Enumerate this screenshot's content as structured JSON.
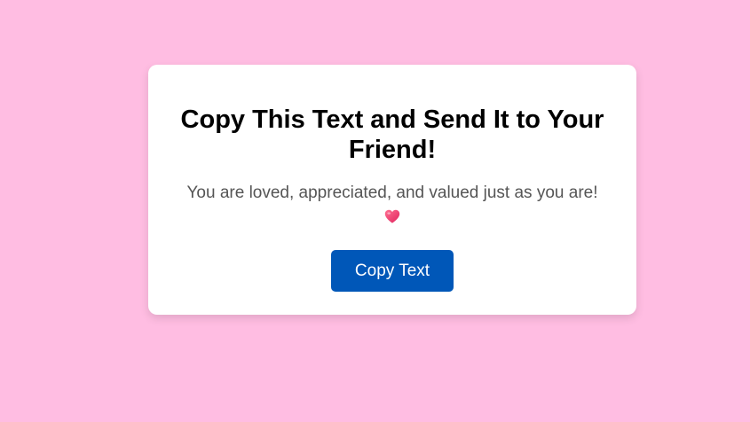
{
  "card": {
    "title": "Copy This Text and Send It to Your Friend!",
    "message": "You are loved, appreciated, and valued just as you are!",
    "message_icon": "heart-icon",
    "button_label": "Copy Text"
  },
  "colors": {
    "background": "#ffbde2",
    "card": "#ffffff",
    "button": "#0057b8",
    "heart": "#f0346a"
  }
}
